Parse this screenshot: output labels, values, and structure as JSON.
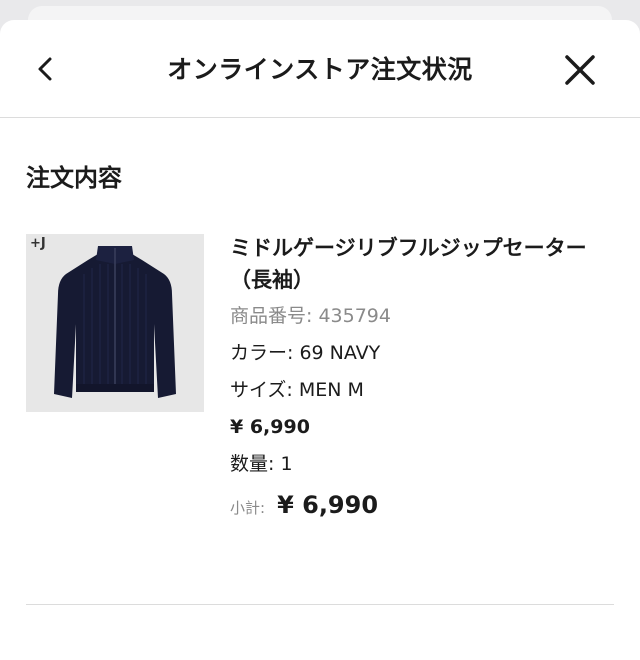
{
  "header": {
    "title": "オンラインストア注文状況"
  },
  "section": {
    "title": "注文内容"
  },
  "product": {
    "badge": "+J",
    "name": "ミドルゲージリブフルジップセーター（長袖）",
    "number_label": "商品番号:",
    "number": "435794",
    "color_label": "カラー:",
    "color": "69 NAVY",
    "size_label": "サイズ:",
    "size": "MEN M",
    "price": "¥ 6,990",
    "quantity_label": "数量:",
    "quantity": "1",
    "subtotal_label": "小計:",
    "subtotal": "¥ 6,990"
  },
  "colors": {
    "sweater": "#161a33",
    "thumb_bg": "#e7e7e7"
  },
  "icons": {
    "back": "chevron-left-icon",
    "close": "close-icon"
  }
}
